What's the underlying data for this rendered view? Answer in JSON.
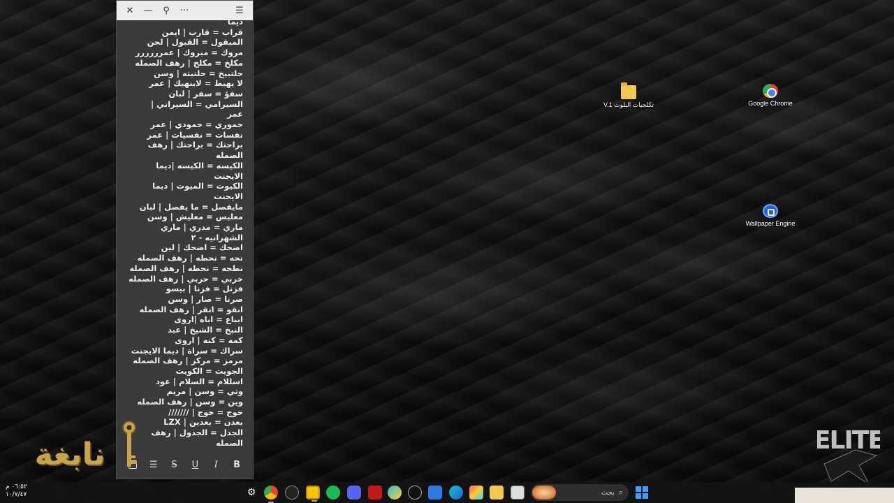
{
  "desktop": {
    "icons": [
      {
        "name": "folder",
        "label": "تكلجيات البلوت V.1"
      },
      {
        "name": "chrome",
        "label": "Google Chrome"
      },
      {
        "name": "wallpaper-engine",
        "label": "Wallpaper Engine"
      }
    ]
  },
  "note": {
    "titlebar": {
      "close_icon": "close-icon",
      "minimize_icon": "minimize-icon",
      "pin_icon": "pin-icon",
      "more_icon": "more-icon",
      "menu_icon": "menu-icon",
      "close": "✕",
      "minimize": "—",
      "pin": "⚲",
      "more": "···",
      "menu": "☰"
    },
    "lines": [
      "ديما",
      "قراب = قارب | ايمن",
      "المبقول = القبول | لحن",
      "مروك = مبروك | عمرررررر",
      "مكلخ = مكلخ | رهف الصمله",
      "حلتبيخ = حلتبته | وسن",
      "لا يهبط = لابنهيك | عمر",
      "سفؤ = سفر | لبان",
      "السيرامي = السيراني |",
      "عمر",
      "حموري = حمودي | عمر",
      "نفسات = نفسيات | عمر",
      "براحتك = براحتك | رهف",
      "الصمله",
      "الكيسه = الكيسه |ديما",
      "الايجنت",
      "الكيوت = الميوت | ديما",
      "الايجنت",
      "مايفصل = ما يفصل | لبان",
      "معليس = معليش | وسن",
      "ماري = مدري | ماري",
      "الشهرانيه - ٢",
      "اضحك = اضحك | لين",
      "نحه = نحطه | رهف الصمله",
      "نطحه = نحطه | رهف الصمله",
      "خربي = حربي | رهف الصمله",
      "فزنل = فزنا | بيسو",
      "صرنا = صار | وسن",
      "انقو = انقر | رهف الصمله",
      "ابباع = اباه |اروى",
      "النبخ = الشيخ | عبد",
      "كمه = كنه | اروى",
      "سراك = سراة | ديما الايجنت",
      "مرمز = مركز | رهف الصمله",
      "الجويت = الكويت",
      "اسللام = السلام | عود",
      "وتي = وسن | مريم",
      "وين = وسن | رهف الصمله",
      "حوج = خوج | ///////",
      "بعدن = بعدين | LZX",
      "الجدل = الجدول | رهف",
      "الصمله"
    ],
    "toolbar": {
      "bold": "B",
      "italic": "I",
      "underline": "U",
      "strike": "S",
      "list": "☰",
      "image_icon": "image-icon"
    }
  },
  "watermarks": {
    "left": "نابغة",
    "right": "ELITE"
  },
  "taskbar": {
    "search_placeholder": "بحث",
    "search_icon": "search-icon",
    "clock_time": "٠٦:٥٢ م",
    "clock_date": "١٠/٧/٤٧",
    "apps": [
      "settings",
      "chrome",
      "steam",
      "sticky-notes",
      "spotify",
      "discord",
      "mcafee",
      "copilot",
      "hp",
      "store",
      "edge",
      "photos",
      "explorer",
      "terminal"
    ]
  }
}
